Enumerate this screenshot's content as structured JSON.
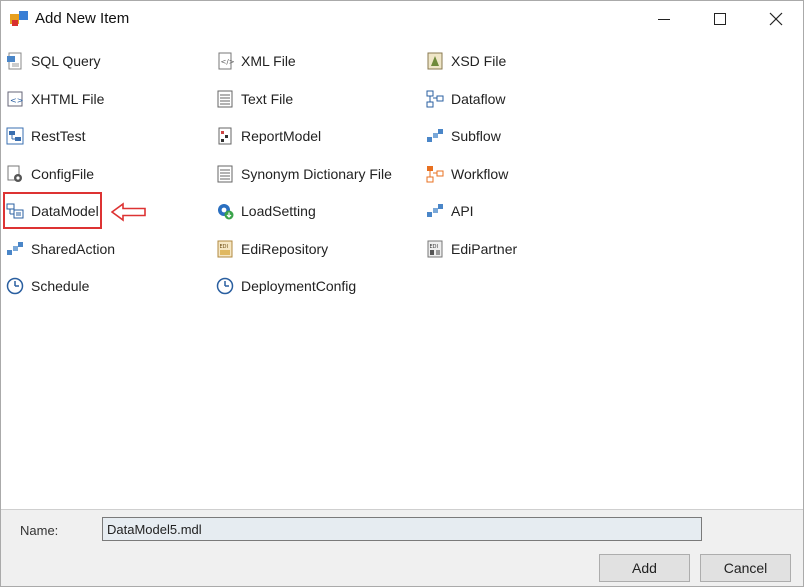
{
  "window": {
    "title": "Add New Item"
  },
  "items": [
    {
      "label": "SQL Query",
      "icon": "sql-query-icon"
    },
    {
      "label": "XML File",
      "icon": "xml-file-icon"
    },
    {
      "label": "XSD File",
      "icon": "xsd-file-icon"
    },
    {
      "label": "XHTML File",
      "icon": "xhtml-file-icon"
    },
    {
      "label": "Text File",
      "icon": "text-file-icon"
    },
    {
      "label": "Dataflow",
      "icon": "dataflow-icon"
    },
    {
      "label": "RestTest",
      "icon": "rest-test-icon"
    },
    {
      "label": "ReportModel",
      "icon": "report-model-icon"
    },
    {
      "label": "Subflow",
      "icon": "subflow-icon"
    },
    {
      "label": "ConfigFile",
      "icon": "config-file-icon"
    },
    {
      "label": "Synonym Dictionary File",
      "icon": "synonym-dictionary-icon"
    },
    {
      "label": "Workflow",
      "icon": "workflow-icon"
    },
    {
      "label": "DataModel",
      "icon": "data-model-icon"
    },
    {
      "label": "LoadSetting",
      "icon": "load-setting-icon"
    },
    {
      "label": "API",
      "icon": "api-icon"
    },
    {
      "label": "SharedAction",
      "icon": "shared-action-icon"
    },
    {
      "label": "EdiRepository",
      "icon": "edi-repository-icon"
    },
    {
      "label": "EdiPartner",
      "icon": "edi-partner-icon"
    },
    {
      "label": "Schedule",
      "icon": "schedule-icon"
    },
    {
      "label": "DeploymentConfig",
      "icon": "deployment-config-icon"
    }
  ],
  "selected_item": "DataModel",
  "name_field": {
    "label": "Name:",
    "value": "DataModel5.mdl"
  },
  "buttons": {
    "add": "Add",
    "cancel": "Cancel"
  },
  "colors": {
    "highlight": "#d33333",
    "input_bg": "#e6ecf1"
  }
}
